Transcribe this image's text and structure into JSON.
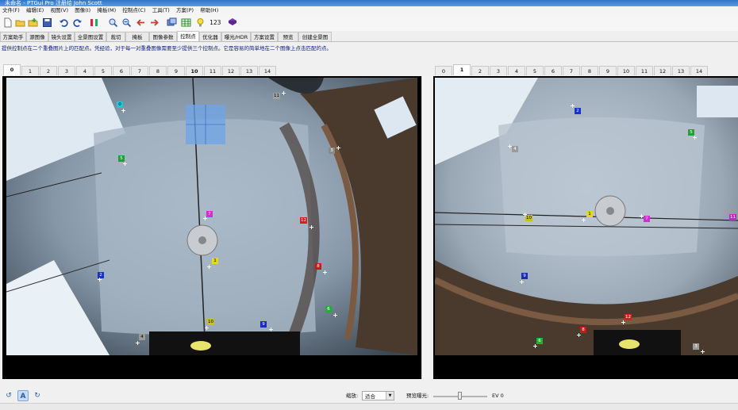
{
  "window": {
    "title": "未命名 - PTGui Pro 注册给 John Scott"
  },
  "menu": [
    "文件(F)",
    "编辑(E)",
    "视图(V)",
    "图像(I)",
    "掩板(M)",
    "控制点(C)",
    "工具(T)",
    "方案(P)",
    "帮助(H)"
  ],
  "toolbar": {
    "counter": "123"
  },
  "tabs": [
    "方案助手",
    "源图像",
    "镜头设置",
    "全景图设置",
    "裁切",
    "掩板",
    "图像参数",
    "控制点",
    "优化器",
    "曝光/HDR",
    "方案设置",
    "预览",
    "创建全景图"
  ],
  "active_tab": "控制点",
  "instruction": "提供控制点在二个重叠图片上的匹配点。凭经验，对于每一对重叠图像需要至少提供三个控制点。它是容易的简单地在二个图像上点击匹配的点。",
  "left_tabs": [
    "0",
    "1",
    "2",
    "3",
    "4",
    "5",
    "6",
    "7",
    "8",
    "9",
    "10",
    "11",
    "12",
    "13",
    "14"
  ],
  "left_active": "0",
  "right_tabs": [
    "0",
    "1",
    "2",
    "3",
    "4",
    "5",
    "6",
    "7",
    "8",
    "9",
    "10",
    "11",
    "12",
    "13",
    "14"
  ],
  "right_active": "1",
  "left_points": [
    {
      "label": "0",
      "color": "#21c7d9"
    },
    {
      "label": "5",
      "color": "#19a532"
    },
    {
      "label": "2",
      "color": "#1633c9"
    },
    {
      "label": "7",
      "color": "#d62ad6"
    },
    {
      "label": "1",
      "color": "#e3d81c"
    },
    {
      "label": "10",
      "color": "#c8c31a"
    },
    {
      "label": "9",
      "color": "#1a2bb8"
    },
    {
      "label": "4",
      "color": "#9a9a9a"
    },
    {
      "label": "12",
      "color": "#d81d1d"
    },
    {
      "label": "8",
      "color": "#c91818"
    },
    {
      "label": "6",
      "color": "#1fb232"
    },
    {
      "label": "3",
      "color": "#8a8a8a"
    },
    {
      "label": "11",
      "color": "#a0a0a0"
    }
  ],
  "right_points": [
    {
      "label": "2",
      "color": "#1633c9"
    },
    {
      "label": "4",
      "color": "#9a9a9a"
    },
    {
      "label": "5",
      "color": "#19a532"
    },
    {
      "label": "10",
      "color": "#c8c31a"
    },
    {
      "label": "1",
      "color": "#e3d81c"
    },
    {
      "label": "7",
      "color": "#d62ad6"
    },
    {
      "label": "11",
      "color": "#c525c5"
    },
    {
      "label": "9",
      "color": "#1a2bb8"
    },
    {
      "label": "12",
      "color": "#d81d1d"
    },
    {
      "label": "8",
      "color": "#c91818"
    },
    {
      "label": "6",
      "color": "#1fb232"
    },
    {
      "label": "3",
      "color": "#9a9a9a"
    }
  ],
  "bottom": {
    "zoom_label": "缩放:",
    "zoom_value": "适合",
    "preview_exposure_label": "预览曝光:",
    "exposure_value": "EV 0",
    "exposure_level": 0.5
  }
}
